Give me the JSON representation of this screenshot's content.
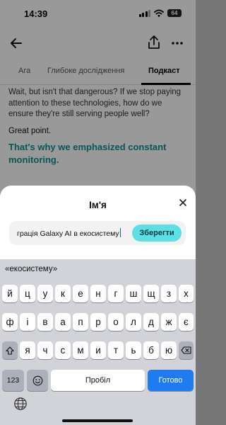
{
  "status": {
    "time": "14:39",
    "battery": "64"
  },
  "tabs": [
    {
      "label": "Ага"
    },
    {
      "label": "Глибоке дослідження"
    },
    {
      "label": "Подкаст"
    }
  ],
  "content": {
    "faded_text": "Wait, but isn't that dangerous? If we stop paying attention to these technologies, how do we ensure they're still serving people well?",
    "normal_text": "Great point.",
    "highlight_text": "That's why we emphasized constant monitoring."
  },
  "sheet": {
    "title": "Ім'я",
    "input_value": "грація Galaxy AI в екосистему",
    "save_label": "Зберегти"
  },
  "keyboard": {
    "suggestion": "«екосистему»",
    "row1": [
      "й",
      "ц",
      "у",
      "к",
      "е",
      "н",
      "г",
      "ш",
      "щ",
      "з",
      "х"
    ],
    "row2": [
      "ф",
      "і",
      "в",
      "а",
      "п",
      "р",
      "о",
      "л",
      "д",
      "ж",
      "є"
    ],
    "row3": [
      "я",
      "ч",
      "с",
      "м",
      "и",
      "т",
      "ь",
      "б",
      "ю"
    ],
    "numbers_label": "123",
    "space_label": "Пробіл",
    "done_label": "Готово"
  },
  "colors": {
    "accent": "#5ce0e3",
    "highlight": "#0f8f8f",
    "done_button": "#1e7cf0"
  }
}
